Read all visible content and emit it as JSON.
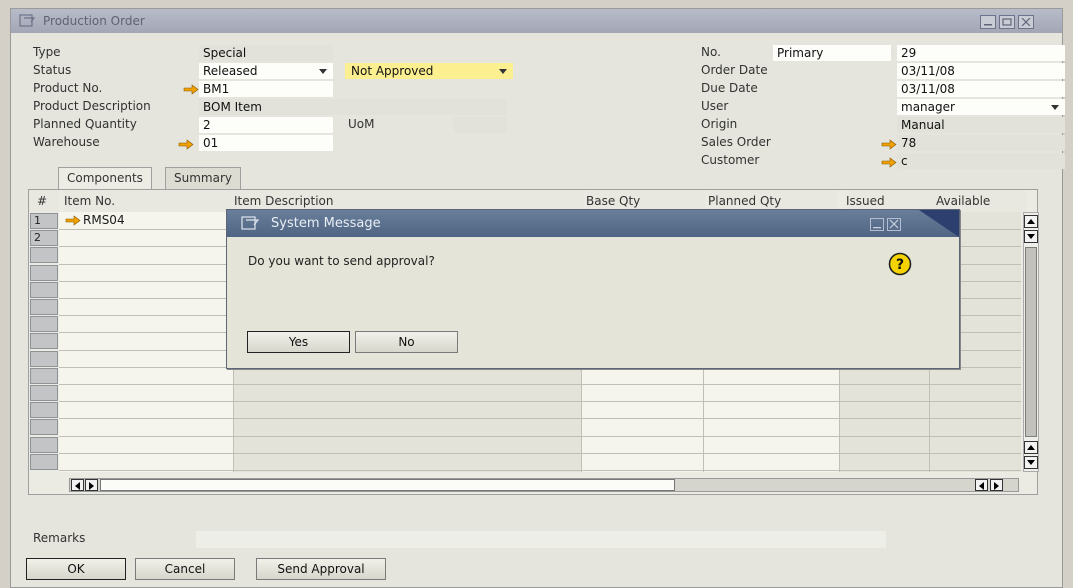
{
  "window": {
    "title": "Production Order"
  },
  "fields_left": {
    "type_label": "Type",
    "type_value": "Special",
    "status_label": "Status",
    "status_value": "Released",
    "approval_value": "Not Approved",
    "product_no_label": "Product No.",
    "product_no_value": "BM1",
    "product_desc_label": "Product Description",
    "product_desc_value": "BOM Item",
    "planned_qty_label": "Planned Quantity",
    "planned_qty_value": "2",
    "uom_label": "UoM",
    "uom_value": "",
    "warehouse_label": "Warehouse",
    "warehouse_value": "01"
  },
  "fields_right": {
    "no_label": "No.",
    "no_series": "Primary",
    "no_value": "29",
    "order_date_label": "Order Date",
    "order_date_value": "03/11/08",
    "due_date_label": "Due Date",
    "due_date_value": "03/11/08",
    "user_label": "User",
    "user_value": "manager",
    "origin_label": "Origin",
    "origin_value": "Manual",
    "sales_order_label": "Sales Order",
    "sales_order_value": "78",
    "customer_label": "Customer",
    "customer_value": "c"
  },
  "tabs": [
    {
      "label": "Components"
    },
    {
      "label": "Summary"
    }
  ],
  "grid": {
    "columns": [
      "#",
      "Item No.",
      "Item Description",
      "Base Qty",
      "Planned Qty",
      "Issued",
      "Available"
    ],
    "rows": [
      {
        "num": "1",
        "item_no": "RMS04"
      },
      {
        "num": "2",
        "item_no": ""
      }
    ]
  },
  "remarks": {
    "label": "Remarks",
    "value": ""
  },
  "buttons": {
    "ok": "OK",
    "cancel": "Cancel",
    "send_approval": "Send Approval"
  },
  "dialog": {
    "title": "System Message",
    "message": "Do you want to send approval?",
    "yes": "Yes",
    "no": "No"
  },
  "colors": {
    "link_arrow": "#f0a000",
    "dialog_title": "#5a6f8d",
    "not_approved_bg": "#fbef8f"
  }
}
